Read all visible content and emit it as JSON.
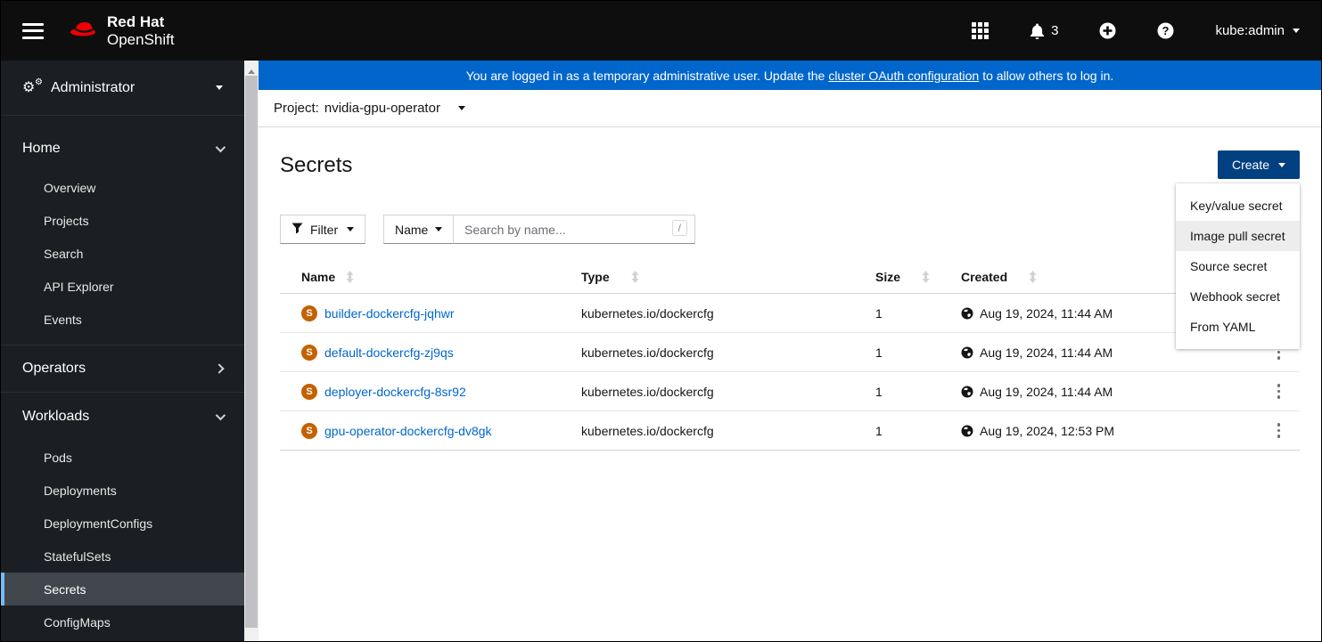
{
  "masthead": {
    "brand_line1": "Red Hat",
    "brand_line2": "OpenShift",
    "notification_count": "3",
    "user": "kube:admin"
  },
  "banner": {
    "prefix": "You are logged in as a temporary administrative user. Update the",
    "link_text": "cluster OAuth configuration",
    "suffix": "to allow others to log in."
  },
  "project_bar": {
    "label": "Project:",
    "value": "nvidia-gpu-operator"
  },
  "sidebar": {
    "perspective": "Administrator",
    "sections": [
      {
        "label": "Home",
        "expanded": true,
        "items": [
          "Overview",
          "Projects",
          "Search",
          "API Explorer",
          "Events"
        ]
      },
      {
        "label": "Operators",
        "expanded": false,
        "items": []
      },
      {
        "label": "Workloads",
        "expanded": true,
        "active_item": "Secrets",
        "items": [
          "Pods",
          "Deployments",
          "DeploymentConfigs",
          "StatefulSets",
          "Secrets",
          "ConfigMaps"
        ]
      }
    ]
  },
  "page": {
    "title": "Secrets"
  },
  "create": {
    "label": "Create",
    "menu_items": [
      "Key/value secret",
      "Image pull secret",
      "Source secret",
      "Webhook secret",
      "From YAML"
    ],
    "highlighted_item": "Image pull secret"
  },
  "toolbar": {
    "filter_label": "Filter",
    "attribute_label": "Name",
    "search_placeholder": "Search by name...",
    "search_shortcut": "/"
  },
  "table": {
    "columns": [
      "Name",
      "Type",
      "Size",
      "Created"
    ],
    "rows": [
      {
        "badge": "S",
        "name": "builder-dockercfg-jqhwr",
        "type": "kubernetes.io/dockercfg",
        "size": "1",
        "created": "Aug 19, 2024, 11:44 AM"
      },
      {
        "badge": "S",
        "name": "default-dockercfg-zj9qs",
        "type": "kubernetes.io/dockercfg",
        "size": "1",
        "created": "Aug 19, 2024, 11:44 AM"
      },
      {
        "badge": "S",
        "name": "deployer-dockercfg-8sr92",
        "type": "kubernetes.io/dockercfg",
        "size": "1",
        "created": "Aug 19, 2024, 11:44 AM"
      },
      {
        "badge": "S",
        "name": "gpu-operator-dockercfg-dv8gk",
        "type": "kubernetes.io/dockercfg",
        "size": "1",
        "created": "Aug 19, 2024, 12:53 PM"
      }
    ]
  },
  "colors": {
    "banner_blue": "#0066cc",
    "create_button_blue": "#004080",
    "link_blue": "#0066cc",
    "secret_badge_orange": "#c46100",
    "nav_active_bar_blue": "#73bcf7"
  }
}
